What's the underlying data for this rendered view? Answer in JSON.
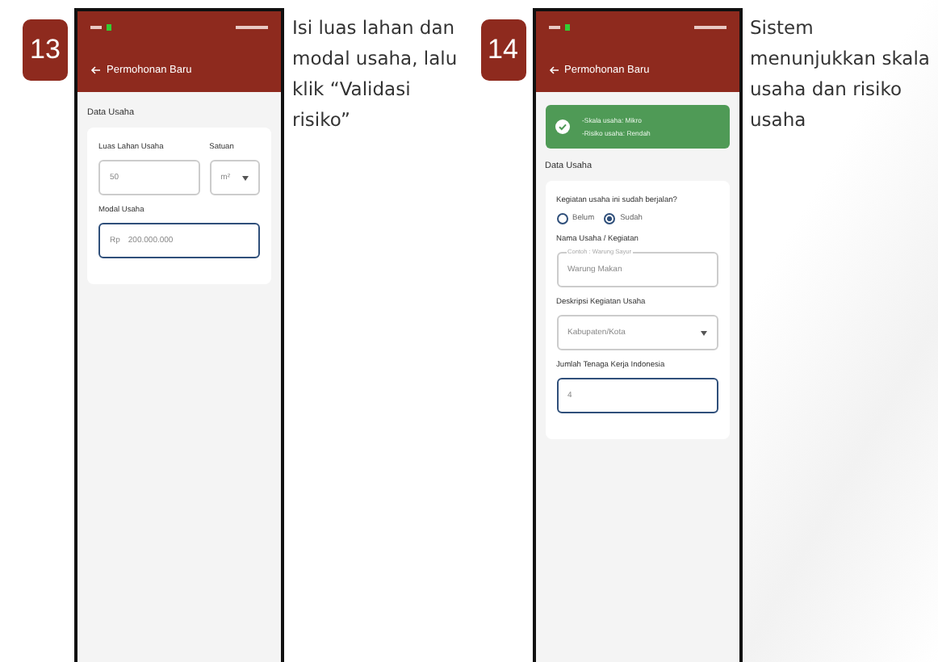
{
  "steps": [
    {
      "number": "13",
      "caption": "Isi luas lahan dan modal usaha, lalu klik “Validasi risiko”",
      "screen": {
        "title": "Permohonan Baru",
        "section": "Data Usaha",
        "fields": [
          {
            "kind": "pair",
            "label": "Luas Lahan Usaha",
            "value": "50",
            "unit_label": "Satuan",
            "unit": "m²",
            "focused": false
          },
          {
            "kind": "money",
            "label": "Modal Usaha",
            "prefix": "Rp",
            "value": "200.000.000",
            "focused": true
          }
        ]
      }
    },
    {
      "number": "14",
      "caption": "Sistem menunjukkan skala usaha dan risiko usaha",
      "screen": {
        "title": "Permohonan Baru",
        "alert": [
          "-Skala usaha: Mikro",
          "-Risiko usaha: Rendah"
        ],
        "section": "Data Usaha",
        "fields": [
          {
            "kind": "radio",
            "label": "Kegiatan usaha ini sudah berjalan?",
            "options": [
              {
                "label": "Belum",
                "selected": false
              },
              {
                "label": "Sudah",
                "selected": true
              }
            ]
          },
          {
            "kind": "text",
            "label": "Nama Usaha / Kegiatan",
            "floating": "Contoh : Warung Sayur",
            "value": "Warung Makan",
            "focused": false
          },
          {
            "kind": "select",
            "label": "Deskripsi Kegiatan Usaha",
            "value": "Kabupaten/Kota",
            "focused": false
          },
          {
            "kind": "text",
            "label": "Jumlah Tenaga Kerja Indonesia",
            "value": "4",
            "focused": true
          }
        ]
      }
    }
  ]
}
